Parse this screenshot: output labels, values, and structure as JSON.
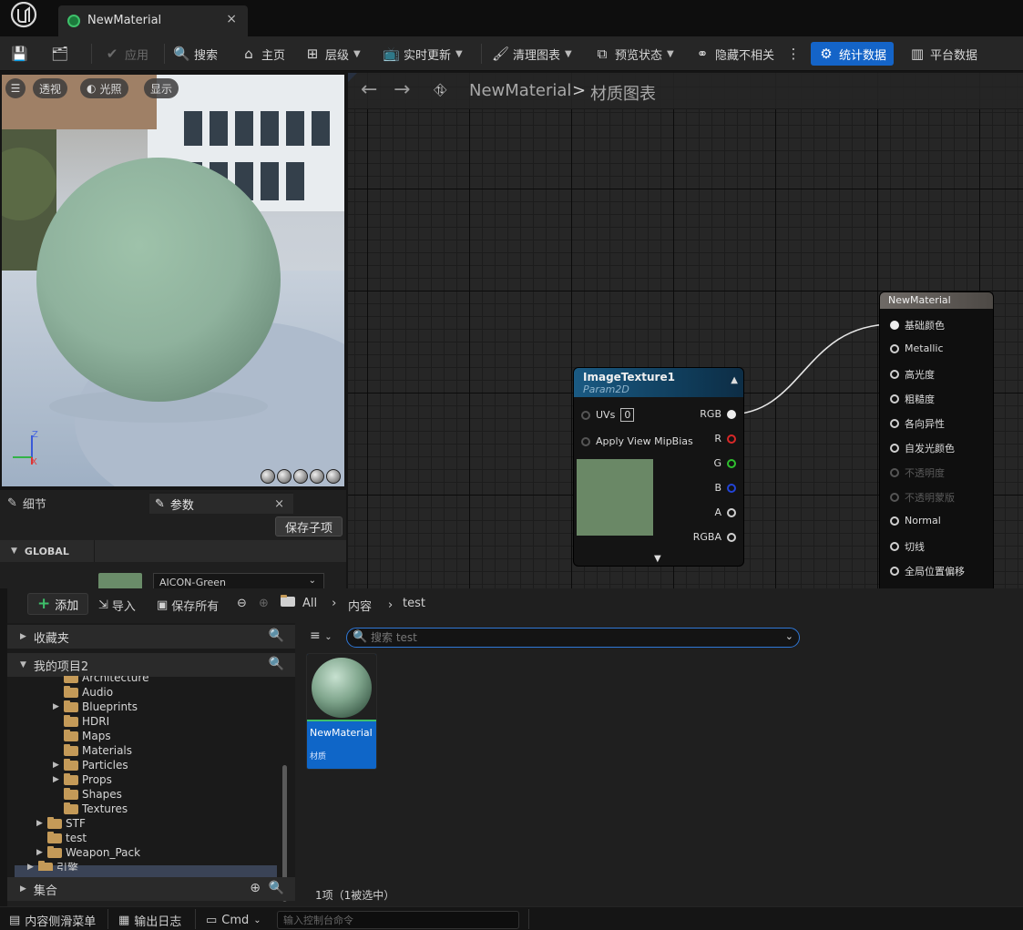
{
  "window": {
    "tab_title": "NewMaterial",
    "tab_close": "×"
  },
  "toolbar": {
    "apply": "应用",
    "search": "搜索",
    "home": "主页",
    "hierarchy": "层级",
    "live_update": "实时更新",
    "clean_graph": "清理图表",
    "preview_state": "预览状态",
    "hide_unrelated": "隐藏不相关",
    "stats": "统计数据",
    "platform_stats": "平台数据"
  },
  "viewport": {
    "perspective": "透视",
    "lit": "光照",
    "show": "显示",
    "axis_z": "Z",
    "axis_x": "X",
    "sphere_color": "#8fb29d"
  },
  "details": {
    "tab_details": "细节",
    "tab_params": "参数",
    "tab_close": "×",
    "save_child": "保存子项",
    "global_label": "GLOBAL",
    "aicon_value": "AICON-Green",
    "aicon_color": "#6a8c69"
  },
  "graph": {
    "breadcrumb_root": "NewMaterial",
    "breadcrumb_sep": ">",
    "breadcrumb_current": "材质图表",
    "texture_node": {
      "title": "ImageTexture1",
      "subtitle": "Param2D",
      "uvs_label": "UVs",
      "uvs_value": "0",
      "mip_label": "Apply View MipBias",
      "outputs": [
        "RGB",
        "R",
        "G",
        "B",
        "A",
        "RGBA"
      ],
      "preview_color": "#6a8866"
    },
    "material_node": {
      "title": "NewMaterial",
      "inputs": [
        "基础颜色",
        "Metallic",
        "高光度",
        "粗糙度",
        "各向异性",
        "自发光颜色",
        "不透明度",
        "不透明蒙版",
        "Normal",
        "切线",
        "全局位置偏移"
      ],
      "disabled": [
        6,
        7
      ]
    }
  },
  "content_browser": {
    "add": "添加",
    "import": "导入",
    "save_all": "保存所有",
    "path": [
      "All",
      "内容",
      "test"
    ],
    "favorites": "收藏夹",
    "project": "我的项目2",
    "tree": [
      {
        "label": "Architecture",
        "indent": 2,
        "expand": false
      },
      {
        "label": "Audio",
        "indent": 2,
        "expand": false
      },
      {
        "label": "Blueprints",
        "indent": 2,
        "expand": true
      },
      {
        "label": "HDRI",
        "indent": 2,
        "expand": false
      },
      {
        "label": "Maps",
        "indent": 2,
        "expand": false
      },
      {
        "label": "Materials",
        "indent": 2,
        "expand": false
      },
      {
        "label": "Particles",
        "indent": 2,
        "expand": true
      },
      {
        "label": "Props",
        "indent": 2,
        "expand": true
      },
      {
        "label": "Shapes",
        "indent": 2,
        "expand": false
      },
      {
        "label": "Textures",
        "indent": 2,
        "expand": false
      },
      {
        "label": "STF",
        "indent": 1,
        "expand": true
      },
      {
        "label": "test",
        "indent": 1,
        "expand": false
      },
      {
        "label": "Weapon_Pack",
        "indent": 1,
        "expand": true
      },
      {
        "label": "引擎",
        "indent": 0,
        "expand": true
      }
    ],
    "collections": "集合",
    "search_placeholder": "搜索 test",
    "asset_name": "NewMaterial",
    "asset_type": "材质",
    "status": "1项（1被选中）"
  },
  "statusbar": {
    "content_drawer": "内容侧滑菜单",
    "output_log": "输出日志",
    "cmd": "Cmd",
    "console_placeholder": "输入控制台命令"
  }
}
